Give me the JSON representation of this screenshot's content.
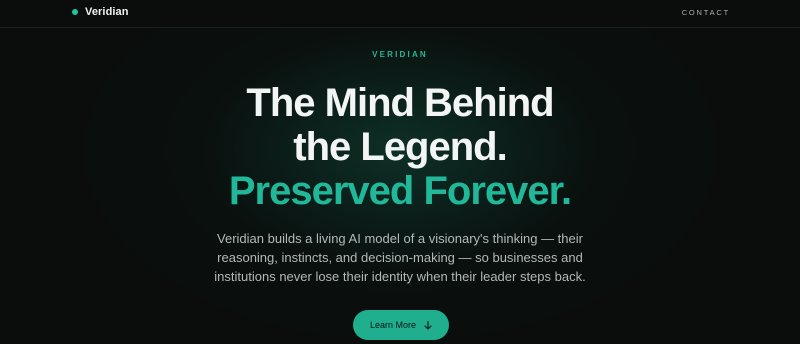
{
  "nav": {
    "brand_name": "Veridian",
    "contact_label": "CONTACT"
  },
  "hero": {
    "eyebrow": "VERIDIAN",
    "headline_line1": "The Mind Behind",
    "headline_line2": "the Legend.",
    "headline_accent": "Preserved Forever.",
    "subtext_line1": "Veridian builds a living AI model of a visionary's thinking — their",
    "subtext_line2": "reasoning, instincts, and decision-making — so businesses and",
    "subtext_line3": "institutions never lose their identity when their leader steps back.",
    "cta_label": "Learn More",
    "cta_icon": "arrow-down-icon"
  },
  "colors": {
    "accent": "#21b89a",
    "button": "#1fae8e",
    "background": "#0a0d0c",
    "heading": "#f3f5f4",
    "body_text": "#b3b9b7"
  }
}
